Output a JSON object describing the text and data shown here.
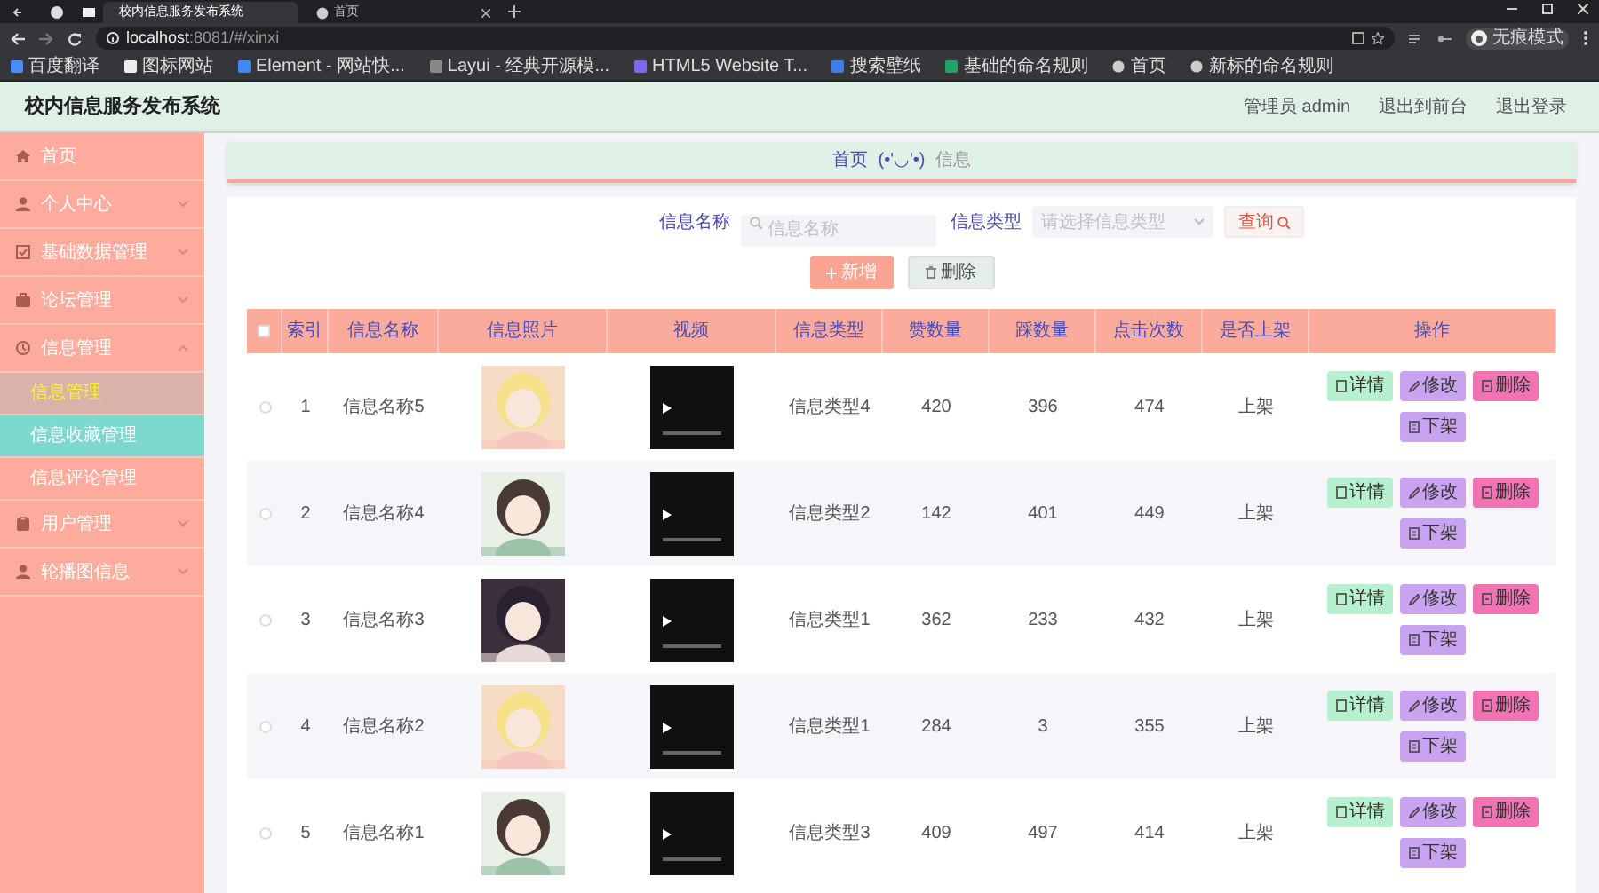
{
  "browser": {
    "tabs": [
      {
        "title": "校内信息服务发布系统",
        "selected": true
      },
      {
        "title": "首页",
        "selected": false
      }
    ],
    "url_host": "localhost",
    "url_rest": ":8081/#/xinxi",
    "profile": "无痕模式",
    "bookmarks": [
      "百度翻译",
      "图标网站",
      "Element - 网站快...",
      "Layui - 经典开源模...",
      "HTML5 Website T...",
      "搜索壁纸",
      "基础的命名规则",
      "首页",
      "新标的命名规则"
    ]
  },
  "header": {
    "title": "校内信息服务发布系统",
    "links": [
      "管理员 admin",
      "退出到前台",
      "退出登录"
    ]
  },
  "sidebar": {
    "items": [
      {
        "label": "首页",
        "kind": "link"
      },
      {
        "label": "个人中心",
        "kind": "group",
        "expanded": false
      },
      {
        "label": "基础数据管理",
        "kind": "group",
        "expanded": false
      },
      {
        "label": "论坛管理",
        "kind": "group",
        "expanded": false
      },
      {
        "label": "信息管理",
        "kind": "group",
        "expanded": true,
        "children": [
          {
            "label": "信息管理",
            "selected": true,
            "hovered": false
          },
          {
            "label": "信息收藏管理",
            "selected": false,
            "hovered": true
          },
          {
            "label": "信息评论管理",
            "selected": false,
            "hovered": false
          }
        ]
      },
      {
        "label": "用户管理",
        "kind": "group",
        "expanded": false
      },
      {
        "label": "轮播图信息",
        "kind": "group",
        "expanded": false
      }
    ]
  },
  "breadcrumb": [
    "首页",
    "(•'◡'•)",
    "信息"
  ],
  "search": {
    "name_label": "信息名称",
    "name_placeholder": "信息名称",
    "type_label": "信息类型",
    "type_placeholder": "请选择信息类型",
    "button": "查询"
  },
  "actions": [
    "新增",
    "删除"
  ],
  "table": {
    "select_all": {
      "checked": false
    },
    "columns": [
      "索引",
      "信息名称",
      "信息照片",
      "视频",
      "信息类型",
      "赞数量",
      "踩数量",
      "点击次数",
      "是否上架",
      "操作"
    ],
    "rows": [
      {
        "checked": false,
        "index": "1",
        "name": "信息名称5",
        "photo": {
          "kind": "picture"
        },
        "type": "信息类型4",
        "likes": "420",
        "dislikes": "396",
        "clicks": "474",
        "on_shelf": "上架",
        "buttons": [
          "详情",
          "修改",
          "删除",
          "下架"
        ]
      },
      {
        "checked": false,
        "index": "2",
        "name": "信息名称4",
        "photo": {
          "kind": "picture"
        },
        "type": "信息类型2",
        "likes": "142",
        "dislikes": "401",
        "clicks": "449",
        "on_shelf": "上架",
        "buttons": [
          "详情",
          "修改",
          "删除",
          "下架"
        ]
      },
      {
        "checked": false,
        "index": "3",
        "name": "信息名称3",
        "photo": {
          "kind": "picture"
        },
        "type": "信息类型1",
        "likes": "362",
        "dislikes": "233",
        "clicks": "432",
        "on_shelf": "上架",
        "buttons": [
          "详情",
          "修改",
          "删除",
          "下架"
        ]
      },
      {
        "checked": false,
        "index": "4",
        "name": "信息名称2",
        "photo": {
          "kind": "picture"
        },
        "type": "信息类型1",
        "likes": "284",
        "dislikes": "3",
        "clicks": "355",
        "on_shelf": "上架",
        "buttons": [
          "详情",
          "修改",
          "删除",
          "下架"
        ]
      },
      {
        "checked": false,
        "index": "5",
        "name": "信息名称1",
        "photo": {
          "kind": "picture"
        },
        "type": "信息类型3",
        "likes": "409",
        "dislikes": "497",
        "clicks": "414",
        "on_shelf": "上架",
        "buttons": [
          "详情",
          "修改",
          "删除",
          "下架"
        ]
      }
    ]
  }
}
